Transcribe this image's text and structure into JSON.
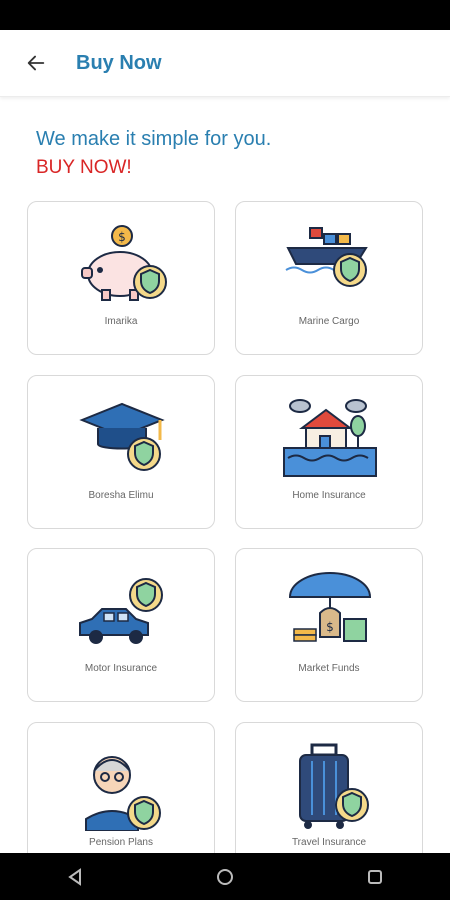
{
  "header": {
    "title": "Buy Now",
    "back_icon": "arrow-left-icon"
  },
  "intro": {
    "tagline": "We make it simple for you.",
    "cta": "BUY NOW!"
  },
  "products": [
    {
      "label": "Imarika",
      "icon": "piggy-bank-shield-icon"
    },
    {
      "label": "Marine Cargo",
      "icon": "cargo-ship-shield-icon"
    },
    {
      "label": "Boresha Elimu",
      "icon": "graduation-cap-shield-icon"
    },
    {
      "label": "Home Insurance",
      "icon": "house-flood-icon"
    },
    {
      "label": "Motor Insurance",
      "icon": "car-shield-icon"
    },
    {
      "label": "Market Funds",
      "icon": "money-umbrella-icon"
    },
    {
      "label": "Pension Plans",
      "icon": "elderly-man-shield-icon"
    },
    {
      "label": "Travel Insurance",
      "icon": "luggage-shield-icon"
    }
  ],
  "system_nav": {
    "back": "nav-back-icon",
    "home": "nav-home-icon",
    "recents": "nav-recents-icon"
  },
  "colors": {
    "brand_blue": "#2a7fb0",
    "cta_red": "#d92626",
    "card_border": "#d9d9d9",
    "shield_green": "#8fd3a0",
    "shield_badge": "#f4d98a"
  }
}
